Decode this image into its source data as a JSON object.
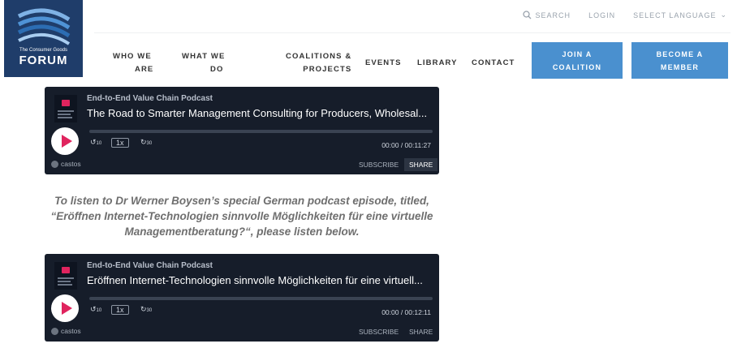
{
  "logo": {
    "tagline": "The Consumer Goods",
    "name": "FORUM"
  },
  "utility": {
    "search": "SEARCH",
    "login": "LOGIN",
    "language": "SELECT LANGUAGE"
  },
  "nav": {
    "who_1": "WHO WE",
    "who_2": "ARE",
    "what_1": "WHAT WE",
    "what_2": "DO",
    "coal_1": "COALITIONS &",
    "coal_2": "PROJECTS",
    "events": "EVENTS",
    "library": "LIBRARY",
    "contact": "CONTACT"
  },
  "buttons": {
    "join_1": "JOIN A",
    "join_2": "COALITION",
    "member_1": "BECOME A",
    "member_2": "MEMBER"
  },
  "players": [
    {
      "show": "End-to-End Value Chain Podcast",
      "title": "The Road to Smarter Management Consulting for Producers, Wholesal...",
      "rewind": "10",
      "speed": "1x",
      "forward": "30",
      "time": "00:00 / 00:11:27",
      "brand": "castos",
      "subscribe": "SUBSCRIBE",
      "share": "SHARE"
    },
    {
      "show": "End-to-End Value Chain Podcast",
      "title": "Eröffnen Internet-Technologien sinnvolle Möglichkeiten für eine virtuell...",
      "rewind": "10",
      "speed": "1x",
      "forward": "30",
      "time": "00:00 / 00:12:11",
      "brand": "castos",
      "subscribe": "SUBSCRIBE",
      "share": "SHARE"
    }
  ],
  "intro": {
    "line1": "To listen to Dr Werner Boysen’s special German podcast episode, titled,",
    "line2": "“Eröffnen Internet-Technologien sinnvolle Möglichkeiten für eine virtuelle",
    "line3": "Managementberatung?“, please listen below."
  },
  "colors": {
    "brand_blue": "#4a90cf",
    "logo_navy": "#1f3d6a",
    "player_bg": "#161d2a",
    "play_pink": "#e0245e"
  }
}
